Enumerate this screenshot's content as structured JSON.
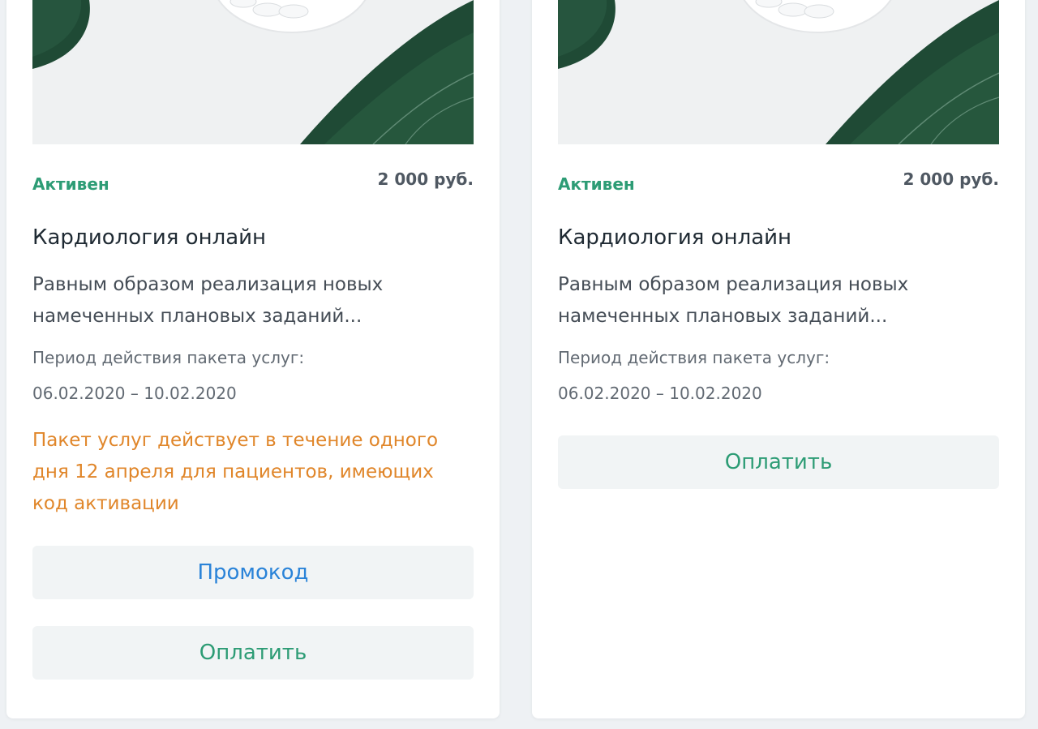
{
  "colors": {
    "status": "#2d9c75",
    "notice": "#e0862a",
    "promo": "#2a83d8",
    "pay": "#2d9c75"
  },
  "cards": [
    {
      "image_icon": "leaves-and-pills-image",
      "status": "Активен",
      "price": "2 000 руб.",
      "title": "Кардиология онлайн",
      "description": "Равным образом реализация новых намеченных плановых заданий...",
      "period_label": "Период действия пакета услуг:",
      "period_dates": "06.02.2020 – 10.02.2020",
      "notice": "Пакет услуг действует в течение одного дня 12 апреля для пациентов, имеющих код активации",
      "promo_button": "Промокод",
      "pay_button": "Оплатить"
    },
    {
      "image_icon": "leaves-and-pills-image",
      "status": "Активен",
      "price": "2 000 руб.",
      "title": "Кардиология онлайн",
      "description": "Равным образом реализация новых намеченных плановых заданий...",
      "period_label": "Период действия пакета услуг:",
      "period_dates": "06.02.2020 – 10.02.2020",
      "pay_button": "Оплатить"
    }
  ]
}
